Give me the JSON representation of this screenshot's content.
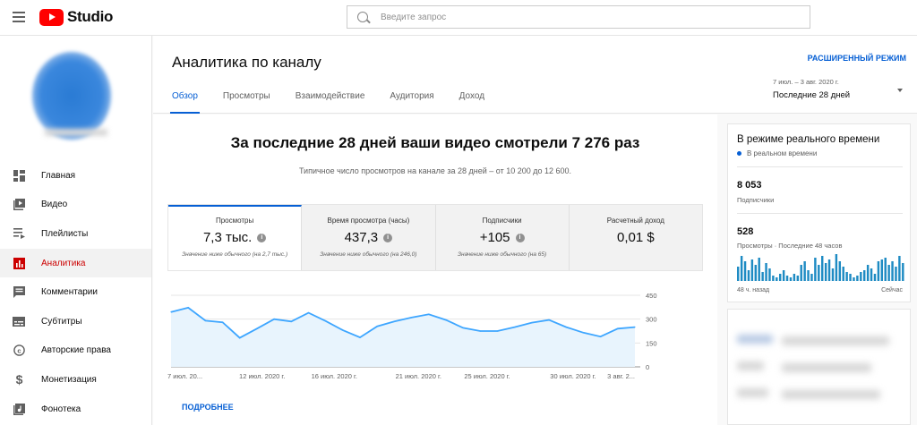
{
  "app": {
    "name": "Studio"
  },
  "search": {
    "placeholder": "Введите запрос"
  },
  "sidebar": {
    "items": [
      {
        "label": "Главная",
        "icon": "dashboard-icon",
        "active": false
      },
      {
        "label": "Видео",
        "icon": "video-icon",
        "active": false
      },
      {
        "label": "Плейлисты",
        "icon": "playlist-icon",
        "active": false
      },
      {
        "label": "Аналитика",
        "icon": "analytics-icon",
        "active": true
      },
      {
        "label": "Комментарии",
        "icon": "comments-icon",
        "active": false
      },
      {
        "label": "Субтитры",
        "icon": "subtitles-icon",
        "active": false
      },
      {
        "label": "Авторские права",
        "icon": "copyright-icon",
        "active": false
      },
      {
        "label": "Монетизация",
        "icon": "dollar-icon",
        "active": false
      },
      {
        "label": "Фонотека",
        "icon": "audio-library-icon",
        "active": false
      }
    ]
  },
  "header": {
    "title": "Аналитика по каналу",
    "advanced_label": "РАСШИРЕННЫЙ РЕЖИМ",
    "tabs": [
      "Обзор",
      "Просмотры",
      "Взаимодействие",
      "Аудитория",
      "Доход"
    ],
    "period_range": "7 июл. – 3 авг. 2020 г.",
    "period_label": "Последние 28 дней"
  },
  "overview": {
    "headline": "За последние 28 дней ваши видео смотрели 7 276 раз",
    "subline": "Типичное число просмотров на канале за 28 дней – от 10 200 до 12 600."
  },
  "cards": [
    {
      "title": "Просмотры",
      "value": "7,3 тыс.",
      "note": "Значение ниже обычного (на 2,7 тыс.)",
      "info": true
    },
    {
      "title": "Время просмотра (часы)",
      "value": "437,3",
      "note": "Значение ниже обычного (на 246,0)",
      "info": true
    },
    {
      "title": "Подписчики",
      "value": "+105",
      "note": "Значение ниже обычного (на 65)",
      "info": true
    },
    {
      "title": "Расчетный доход",
      "value": "0,01 $",
      "note": "",
      "info": false
    }
  ],
  "more_label": "ПОДРОБНЕЕ",
  "chart_data": {
    "type": "line",
    "x_tick_labels": [
      "7 июл. 20...",
      "12 июл. 2020 г.",
      "16 июл. 2020 г.",
      "21 июл. 2020 г.",
      "25 июл. 2020 г.",
      "30 июл. 2020 г.",
      "3 авг. 2..."
    ],
    "y_ticks": [
      0,
      150,
      300,
      450
    ],
    "ylim": [
      0,
      450
    ],
    "series": [
      {
        "values": [
          345,
          372,
          290,
          280,
          182,
          240,
          300,
          285,
          340,
          288,
          230,
          185,
          255,
          285,
          310,
          330,
          295,
          245,
          225,
          225,
          250,
          278,
          295,
          250,
          215,
          190,
          240,
          250
        ]
      }
    ],
    "grid": true,
    "color": "#3ea6ff"
  },
  "realtime": {
    "title": "В режиме реального времени",
    "live_label": "В реальном времени",
    "subs_value": "8 053",
    "subs_label": "Подписчики",
    "views_value": "528",
    "views_label": "Просмотры · Последние 48 часов",
    "axis_left": "48 ч. назад",
    "axis_right": "Сейчас",
    "bars": [
      8,
      14,
      11,
      6,
      12,
      9,
      13,
      5,
      10,
      7,
      3,
      2,
      4,
      6,
      3,
      2,
      4,
      3,
      9,
      11,
      6,
      4,
      13,
      9,
      14,
      10,
      12,
      7,
      15,
      11,
      8,
      5,
      4,
      2,
      3,
      5,
      6,
      9,
      7,
      4,
      11,
      12,
      13,
      9,
      11,
      8,
      14,
      10
    ]
  },
  "colors": {
    "accent": "#065fd4",
    "active_nav": "#cc0000",
    "chart_line": "#3ea6ff",
    "chart_fill": "#e8f4fd"
  }
}
